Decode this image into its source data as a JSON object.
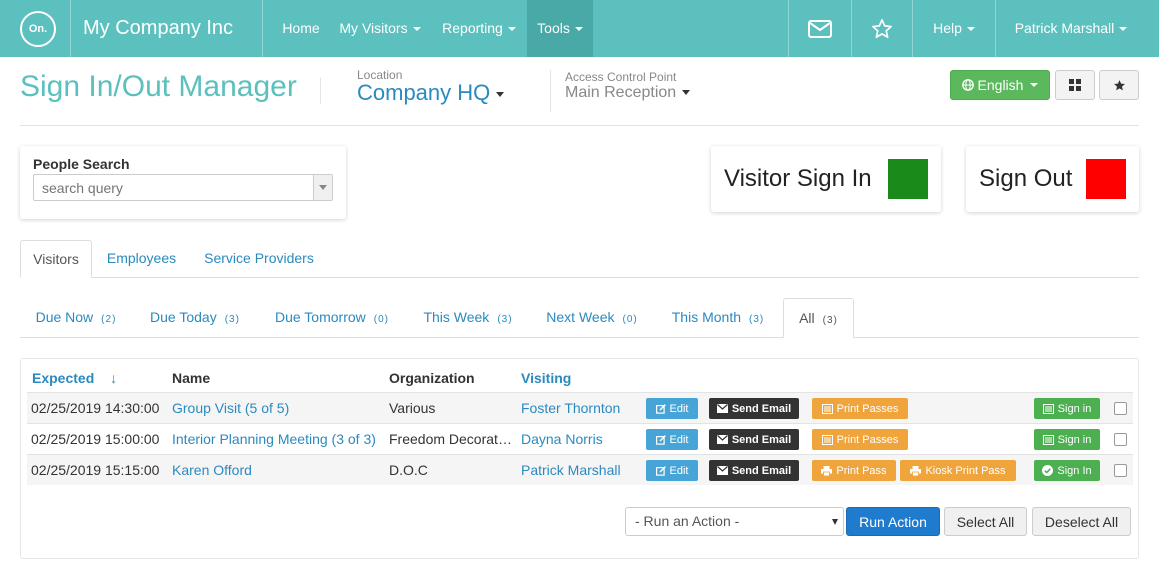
{
  "topnav": {
    "logo_text": "On.",
    "brand": "My Company Inc",
    "items": [
      {
        "label": "Home"
      },
      {
        "label": "My Visitors"
      },
      {
        "label": "Reporting"
      },
      {
        "label": "Tools"
      }
    ],
    "help_label": "Help",
    "user_label": "Patrick Marshall",
    "icons": [
      "mail-icon",
      "star-icon"
    ]
  },
  "header": {
    "title": "Sign In/Out Manager",
    "location_label": "Location",
    "location_value": "Company HQ",
    "acp_label": "Access Control Point",
    "acp_value": "Main Reception",
    "language": "English",
    "accent_color": "#5bc0be"
  },
  "people_search": {
    "label": "People Search",
    "placeholder": "search query"
  },
  "actions": {
    "visitor_sign_in": "Visitor Sign In",
    "visitor_sign_in_color": "#1a8a1a",
    "sign_out": "Sign Out",
    "sign_out_color": "#ff0000"
  },
  "tabs": [
    {
      "label": "Visitors",
      "active": true
    },
    {
      "label": "Employees"
    },
    {
      "label": "Service Providers"
    }
  ],
  "subtabs": [
    {
      "label": "Due Now",
      "count": "(2)"
    },
    {
      "label": "Due Today",
      "count": "(3)"
    },
    {
      "label": "Due Tomorrow",
      "count": "(0)"
    },
    {
      "label": "This Week",
      "count": "(3)"
    },
    {
      "label": "Next Week",
      "count": "(0)"
    },
    {
      "label": "This Month",
      "count": "(3)"
    },
    {
      "label": "All",
      "count": "(3)",
      "active": true
    }
  ],
  "table": {
    "columns": {
      "expected": "Expected",
      "sort_arrow": "↓",
      "name": "Name",
      "organization": "Organization",
      "visiting": "Visiting"
    },
    "rows": [
      {
        "expected": "02/25/2019 14:30:00",
        "name": "Group Visit (5 of 5)",
        "organization": "Various",
        "visiting": "Foster Thornton",
        "btn_edit": "Edit",
        "btn_email": "Send Email",
        "btn_print": "Print Passes",
        "btn_sign": "Sign in"
      },
      {
        "expected": "02/25/2019 15:00:00",
        "name": "Interior Planning Meeting (3 of 3)",
        "organization": "Freedom Decorators",
        "visiting": "Dayna Norris",
        "btn_edit": "Edit",
        "btn_email": "Send Email",
        "btn_print": "Print Passes",
        "btn_sign": "Sign in"
      },
      {
        "expected": "02/25/2019 15:15:00",
        "name": "Karen Offord",
        "organization": "D.O.C",
        "visiting": "Patrick Marshall",
        "btn_edit": "Edit",
        "btn_email": "Send Email",
        "btn_print": "Print Pass",
        "btn_kiosk": "Kiosk Print Pass",
        "btn_sign": "Sign In"
      }
    ]
  },
  "footer": {
    "run_action_placeholder": "- Run an Action -",
    "run_action_btn": "Run Action",
    "select_all": "Select All",
    "deselect_all": "Deselect All"
  }
}
